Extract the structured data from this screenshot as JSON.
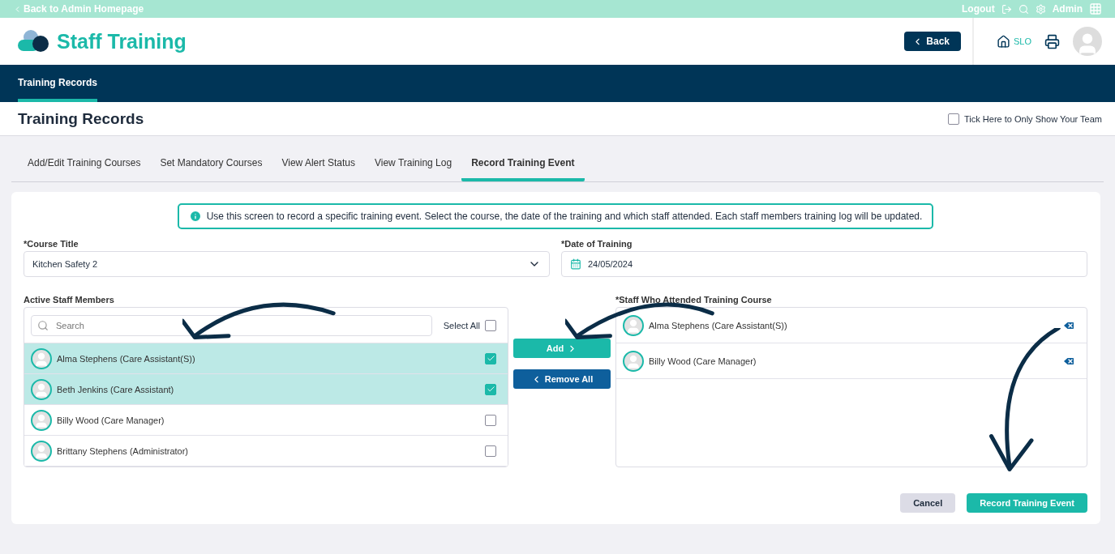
{
  "top_bar": {
    "back_link": "Back to Admin Homepage",
    "logout": "Logout",
    "user": "Admin"
  },
  "header": {
    "app_title": "Staff Training",
    "back_button": "Back",
    "location": "SLO"
  },
  "nav": [
    {
      "label": "Training Records",
      "selected": true
    }
  ],
  "page_title": "Training Records",
  "team_filter": {
    "label": "Tick Here to Only Show Your Team",
    "checked": false
  },
  "tabs": [
    {
      "label": "Add/Edit Training Courses",
      "selected": false
    },
    {
      "label": "Set Mandatory Courses",
      "selected": false
    },
    {
      "label": "View Alert Status",
      "selected": false
    },
    {
      "label": "View Training Log",
      "selected": false
    },
    {
      "label": "Record Training Event",
      "selected": true
    }
  ],
  "info_message": "Use this screen to record a specific training event. Select the course, the date of the training and which staff attended. Each staff members training log will be updated.",
  "course_title": {
    "label": "*Course Title",
    "value": "Kitchen Safety 2"
  },
  "date_of_training": {
    "label": "*Date of Training",
    "value": "24/05/2024"
  },
  "active_staff": {
    "label": "Active Staff Members",
    "search_placeholder": "Search",
    "select_all": {
      "label": "Select All",
      "checked": false
    },
    "members": [
      {
        "name": "Alma Stephens (Care Assistant(S))",
        "selected": true
      },
      {
        "name": "Beth Jenkins (Care Assistant)",
        "selected": true
      },
      {
        "name": "Billy Wood (Care Manager)",
        "selected": false
      },
      {
        "name": "Brittany Stephens (Administrator)",
        "selected": false
      }
    ]
  },
  "transfer_buttons": {
    "add": "Add",
    "remove_all": "Remove All"
  },
  "attended": {
    "label": "*Staff Who Attended Training Course",
    "members": [
      {
        "name": "Alma Stephens (Care Assistant(S))"
      },
      {
        "name": "Billy Wood (Care Manager)"
      }
    ]
  },
  "actions": {
    "cancel": "Cancel",
    "submit": "Record Training Event"
  }
}
